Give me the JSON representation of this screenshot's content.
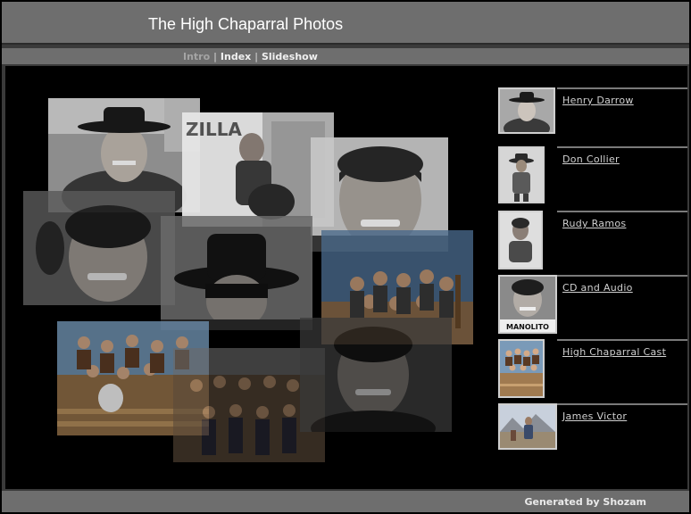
{
  "header": {
    "title": "The High Chaparral Photos"
  },
  "nav": {
    "intro": "Intro",
    "sep1": "|",
    "index": "Index",
    "sep2": "|",
    "slideshow": "Slideshow"
  },
  "index": {
    "items": [
      {
        "label": "Henry Darrow"
      },
      {
        "label": "Don Collier"
      },
      {
        "label": "Rudy Ramos"
      },
      {
        "label": "CD and Audio",
        "thumb_caption": "MANOLITO"
      },
      {
        "label": "High Chaparral Cast"
      },
      {
        "label": "James Victor"
      }
    ]
  },
  "footer": {
    "text": "Generated by Shozam"
  },
  "colors": {
    "bar": "#6e6e6e",
    "content_bg": "#000000",
    "link": "#d0d0d0"
  }
}
